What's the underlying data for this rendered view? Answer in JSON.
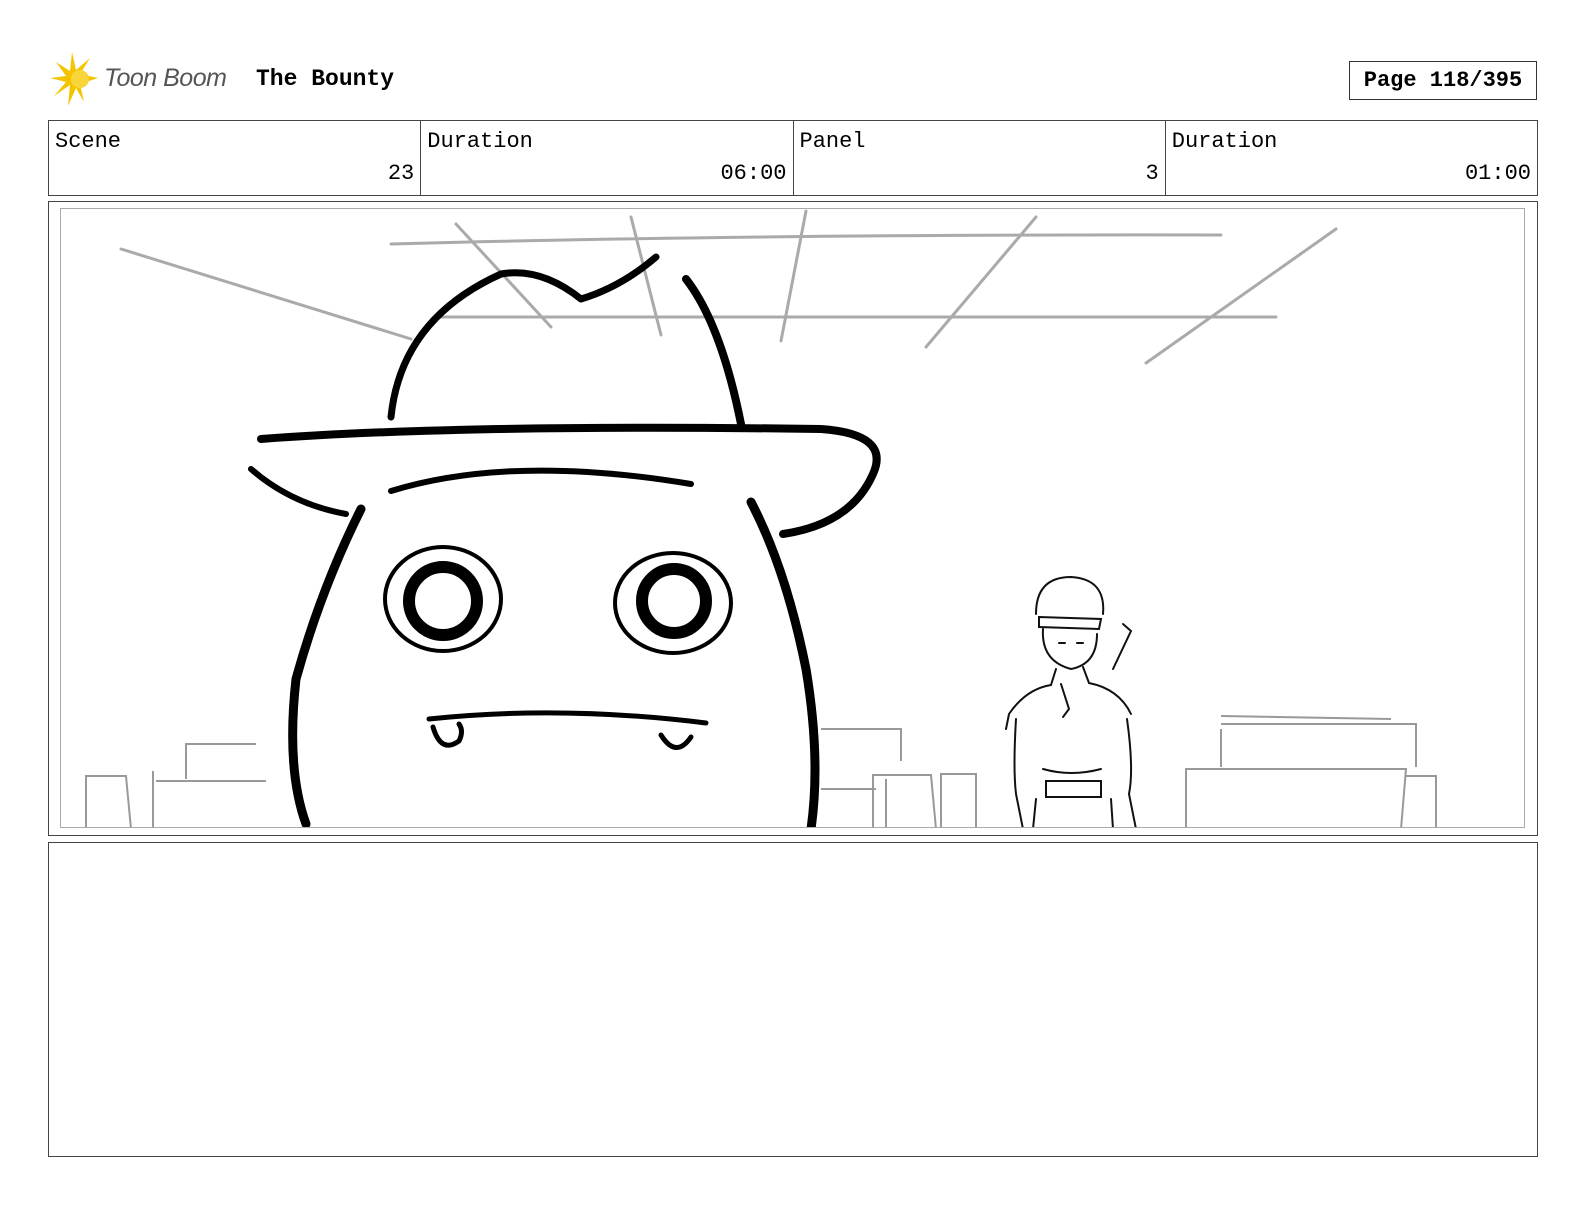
{
  "header": {
    "logo_text": "Toon Boom",
    "project_title": "The Bounty",
    "page_label": "Page 118/395"
  },
  "info": {
    "scene_label": "Scene",
    "scene_value": "23",
    "scene_duration_label": "Duration",
    "scene_duration_value": "06:00",
    "panel_label": "Panel",
    "panel_value": "3",
    "panel_duration_label": "Duration",
    "panel_duration_value": "01:00"
  },
  "colors": {
    "logo_accent": "#f5c400",
    "sketch_ink": "#000000",
    "sketch_light": "#aaaaaa"
  },
  "notes": {
    "text": ""
  }
}
